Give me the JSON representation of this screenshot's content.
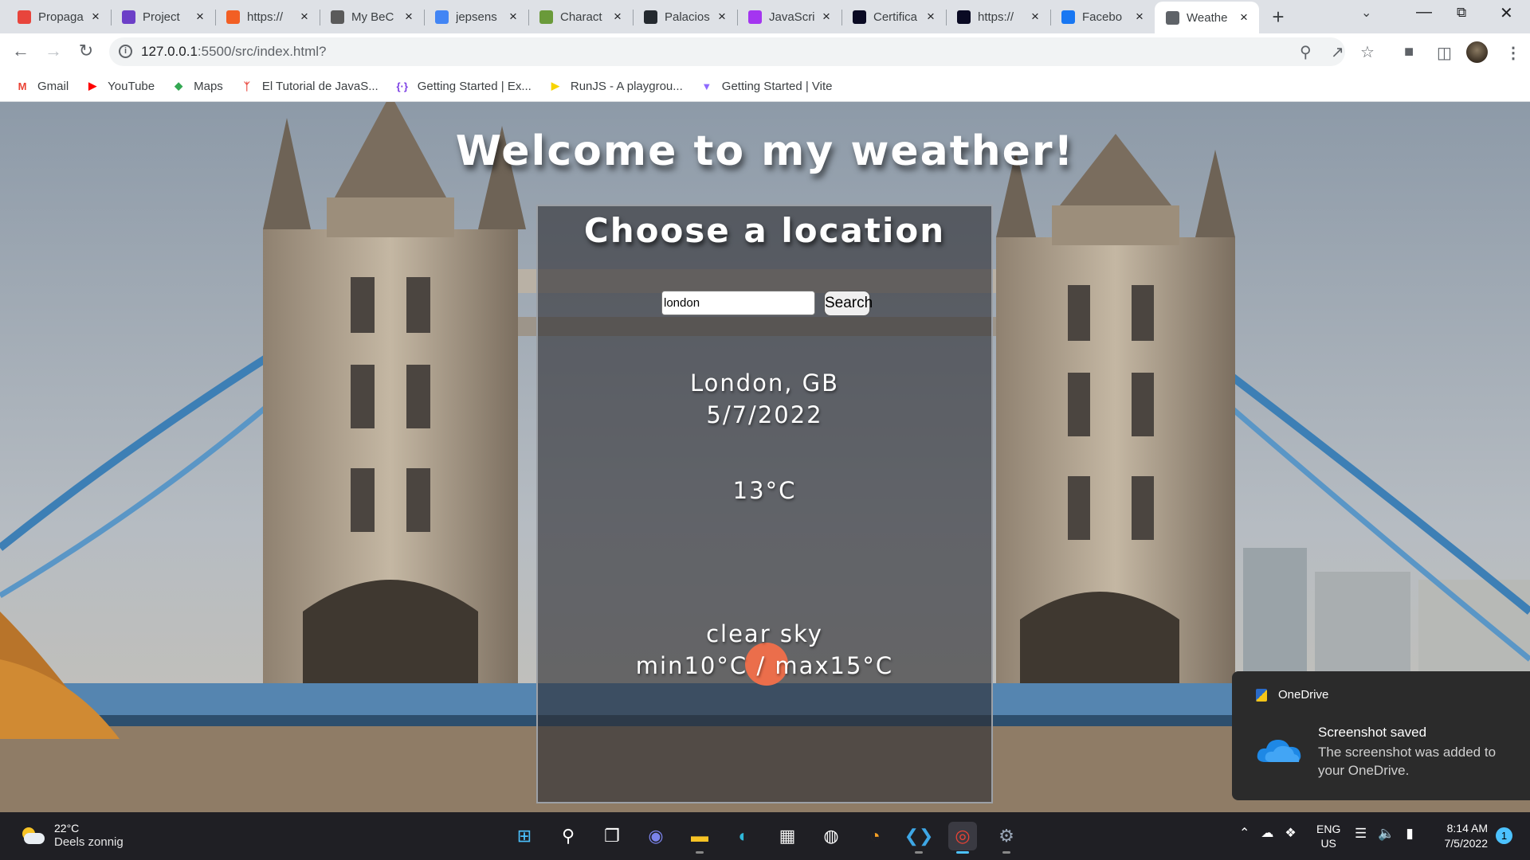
{
  "browser": {
    "tabs": [
      {
        "label": "Propaga",
        "favicon": "red-figure-icon",
        "color": "#e8453c"
      },
      {
        "label": "Project",
        "favicon": "purple-list-icon",
        "color": "#6c3fc7"
      },
      {
        "label": "https://",
        "favicon": "orange-circle-icon",
        "color": "#f25f24"
      },
      {
        "label": "My BeC",
        "favicon": "badge-icon",
        "color": "#5a5a5a"
      },
      {
        "label": "jepsens",
        "favicon": "google-g-icon",
        "color": "#4285f4"
      },
      {
        "label": "Charact",
        "favicon": "character-icon",
        "color": "#6a9a3a"
      },
      {
        "label": "Palacios",
        "favicon": "github-icon",
        "color": "#24292f"
      },
      {
        "label": "JavaScri",
        "favicon": "purple-u-icon",
        "color": "#a435f0"
      },
      {
        "label": "Certifica",
        "favicon": "freecodecamp-icon",
        "color": "#0a0a23"
      },
      {
        "label": "https://",
        "favicon": "freecodecamp-icon",
        "color": "#0a0a23"
      },
      {
        "label": "Facebo",
        "favicon": "facebook-icon",
        "color": "#1877f2"
      },
      {
        "label": "Weathe",
        "favicon": "globe-icon",
        "color": "#5f6368",
        "active": true
      }
    ],
    "url_host": "127.0.0.1",
    "url_rest": ":5500/src/index.html?",
    "bookmarks": [
      {
        "label": "Gmail",
        "icon": "gmail-icon",
        "color": "#ea4335",
        "glyph": "M"
      },
      {
        "label": "YouTube",
        "icon": "youtube-icon",
        "color": "#ff0000",
        "glyph": "▶"
      },
      {
        "label": "Maps",
        "icon": "maps-icon",
        "color": "#34a853",
        "glyph": "◆"
      },
      {
        "label": "El Tutorial de JavaS...",
        "icon": "red-figure-icon",
        "color": "#e8453c",
        "glyph": "ᛉ"
      },
      {
        "label": "Getting Started | Ex...",
        "icon": "brackets-icon",
        "color": "#7b3fe4",
        "glyph": "{·}"
      },
      {
        "label": "RunJS - A playgrou...",
        "icon": "runjs-icon",
        "color": "#f7d400",
        "glyph": "▶"
      },
      {
        "label": "Getting Started | Vite",
        "icon": "vite-icon",
        "color": "#8f6bff",
        "glyph": "▼"
      }
    ]
  },
  "page": {
    "title": "Welcome to my weather!",
    "card_title": "Choose a location",
    "search_value": "london",
    "search_button": "Search",
    "location": "London, GB",
    "date": "5/7/2022",
    "temperature": "13°C",
    "description": "clear sky",
    "min_max": "min10°C / max15°C",
    "icon_color": "#eb6e4b"
  },
  "toast": {
    "app": "OneDrive",
    "title": "Screenshot saved",
    "body": "The screenshot was added to your OneDrive."
  },
  "taskbar": {
    "weather_temp": "22°C",
    "weather_desc": "Deels zonnig",
    "lang_line1": "ENG",
    "lang_line2": "US",
    "time": "8:14 AM",
    "date": "7/5/2022",
    "notifications": "1",
    "apps": [
      "start-icon",
      "search-icon",
      "task-view-icon",
      "teams-chat-icon",
      "file-explorer-icon",
      "edge-icon",
      "store-icon",
      "github-desktop-icon",
      "swift-icon",
      "vscode-icon",
      "chrome-icon",
      "settings-icon"
    ]
  }
}
